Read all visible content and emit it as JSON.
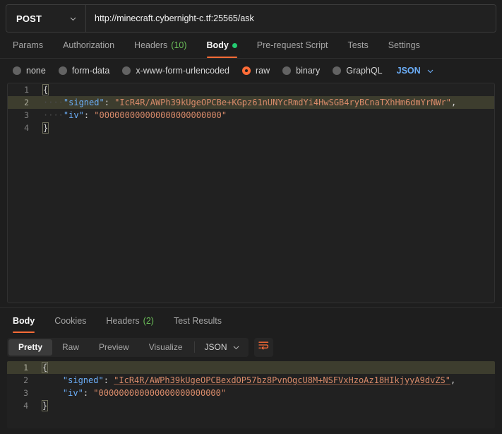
{
  "request": {
    "method": "POST",
    "url": "http://minecraft.cybernight-c.tf:25565/ask",
    "tabs": [
      {
        "label": "Params",
        "count": "",
        "active": false,
        "dot": false
      },
      {
        "label": "Authorization",
        "count": "",
        "active": false,
        "dot": false
      },
      {
        "label": "Headers",
        "count": "(10)",
        "active": false,
        "dot": false
      },
      {
        "label": "Body",
        "count": "",
        "active": true,
        "dot": true
      },
      {
        "label": "Pre-request Script",
        "count": "",
        "active": false,
        "dot": false
      },
      {
        "label": "Tests",
        "count": "",
        "active": false,
        "dot": false
      },
      {
        "label": "Settings",
        "count": "",
        "active": false,
        "dot": false
      }
    ],
    "body_types": [
      {
        "label": "none",
        "selected": false
      },
      {
        "label": "form-data",
        "selected": false
      },
      {
        "label": "x-www-form-urlencoded",
        "selected": false
      },
      {
        "label": "raw",
        "selected": true
      },
      {
        "label": "binary",
        "selected": false
      },
      {
        "label": "GraphQL",
        "selected": false
      }
    ],
    "format": "JSON",
    "editor": {
      "lines": [
        "1",
        "2",
        "3",
        "4"
      ],
      "highlighted_line": 2,
      "open_brace": "{",
      "close_brace": "}",
      "indent": "····",
      "key_signed": "\"signed\"",
      "key_iv": "\"iv\"",
      "colon": ": ",
      "value_signed": "\"IcR4R/AWPh39kUgeOPCBe+KGpz61nUNYcRmdYi4HwSGB4ryBCnaTXhHm6dmYrNWr\"",
      "value_signed_comma": ",",
      "value_iv": "\"000000000000000000000000\""
    }
  },
  "response": {
    "tabs": [
      {
        "label": "Body",
        "count": "",
        "active": true
      },
      {
        "label": "Cookies",
        "count": "",
        "active": false
      },
      {
        "label": "Headers",
        "count": "(2)",
        "active": false
      },
      {
        "label": "Test Results",
        "count": "",
        "active": false
      }
    ],
    "view_modes": [
      {
        "label": "Pretty",
        "active": true
      },
      {
        "label": "Raw",
        "active": false
      },
      {
        "label": "Preview",
        "active": false
      },
      {
        "label": "Visualize",
        "active": false
      }
    ],
    "format": "JSON",
    "wrap_icon": "word-wrap-icon",
    "editor": {
      "lines": [
        "1",
        "2",
        "3",
        "4"
      ],
      "highlighted_line": 1,
      "open_brace": "{",
      "close_brace": "}",
      "indent": "    ",
      "key_signed": "\"signed\"",
      "key_iv": "\"iv\"",
      "colon": ": ",
      "value_signed": "\"IcR4R/AWPh39kUgeOPCBexdOP57bz8PvnOgcU8M+NSFVxHzoAz18HIkjyyA9dvZS\"",
      "value_signed_comma": ",",
      "value_iv": "\"000000000000000000000000\""
    }
  },
  "colors": {
    "accent": "#ff6c37",
    "json_blue": "#6badf7",
    "count_green": "#6bbf59",
    "dot_green": "#23cc71",
    "editor_bg": "#212121",
    "highlight_line": "#3d3d2e",
    "string_orange": "#d98b6a"
  }
}
